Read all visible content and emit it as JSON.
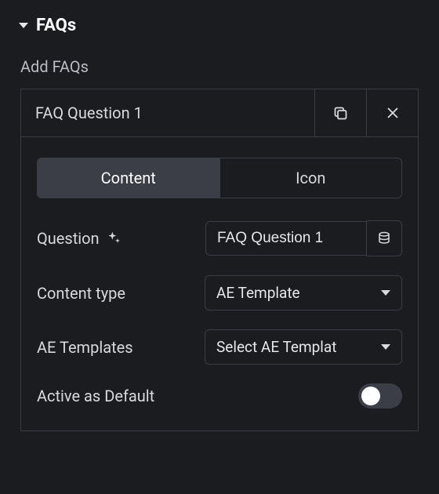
{
  "section": {
    "title": "FAQs"
  },
  "subtitle": "Add FAQs",
  "item": {
    "title": "FAQ Question 1"
  },
  "tabs": {
    "content": "Content",
    "icon": "Icon"
  },
  "fields": {
    "question_label": "Question",
    "question_value": "FAQ Question 1",
    "content_type_label": "Content type",
    "content_type_value": "AE Template",
    "ae_templates_label": "AE Templates",
    "ae_templates_value": "Select AE Templat",
    "active_default_label": "Active as Default"
  }
}
